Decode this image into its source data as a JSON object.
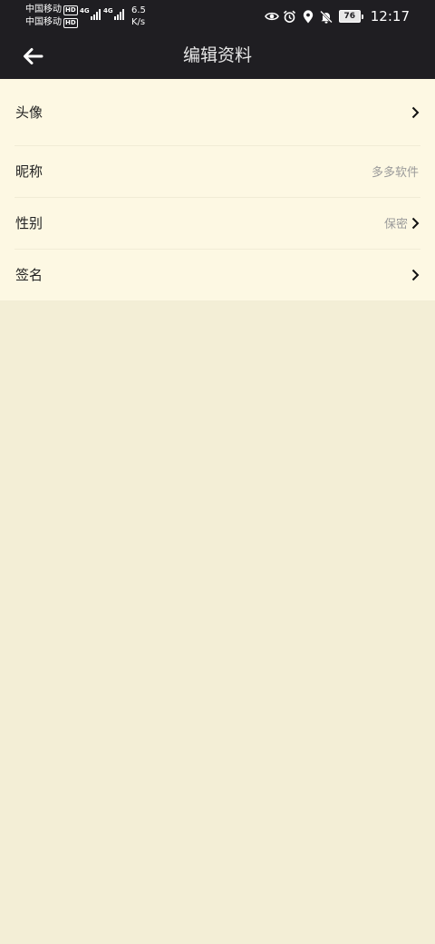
{
  "status_bar": {
    "carrier_1": "中国移动",
    "carrier_2": "中国移动",
    "hd_badge": "HD",
    "net_type": "4G",
    "speed_value": "6.5",
    "speed_unit": "K/s",
    "battery_level": "76",
    "time": "12:17",
    "icons": [
      "eye-icon",
      "alarm-icon",
      "location-icon",
      "mute-bell-icon",
      "battery-icon"
    ]
  },
  "header": {
    "title": "编辑资料",
    "back_icon": "arrow-left-icon"
  },
  "profile": {
    "rows": [
      {
        "label": "头像",
        "value": "",
        "has_chevron": true
      },
      {
        "label": "昵称",
        "value": "多多软件",
        "has_chevron": false
      },
      {
        "label": "性别",
        "value": "保密",
        "has_chevron": true
      },
      {
        "label": "签名",
        "value": "",
        "has_chevron": true
      }
    ]
  },
  "colors": {
    "header_bg": "#1f1e22",
    "list_bg": "#fdf8e3",
    "page_bg": "#f3eed6"
  }
}
